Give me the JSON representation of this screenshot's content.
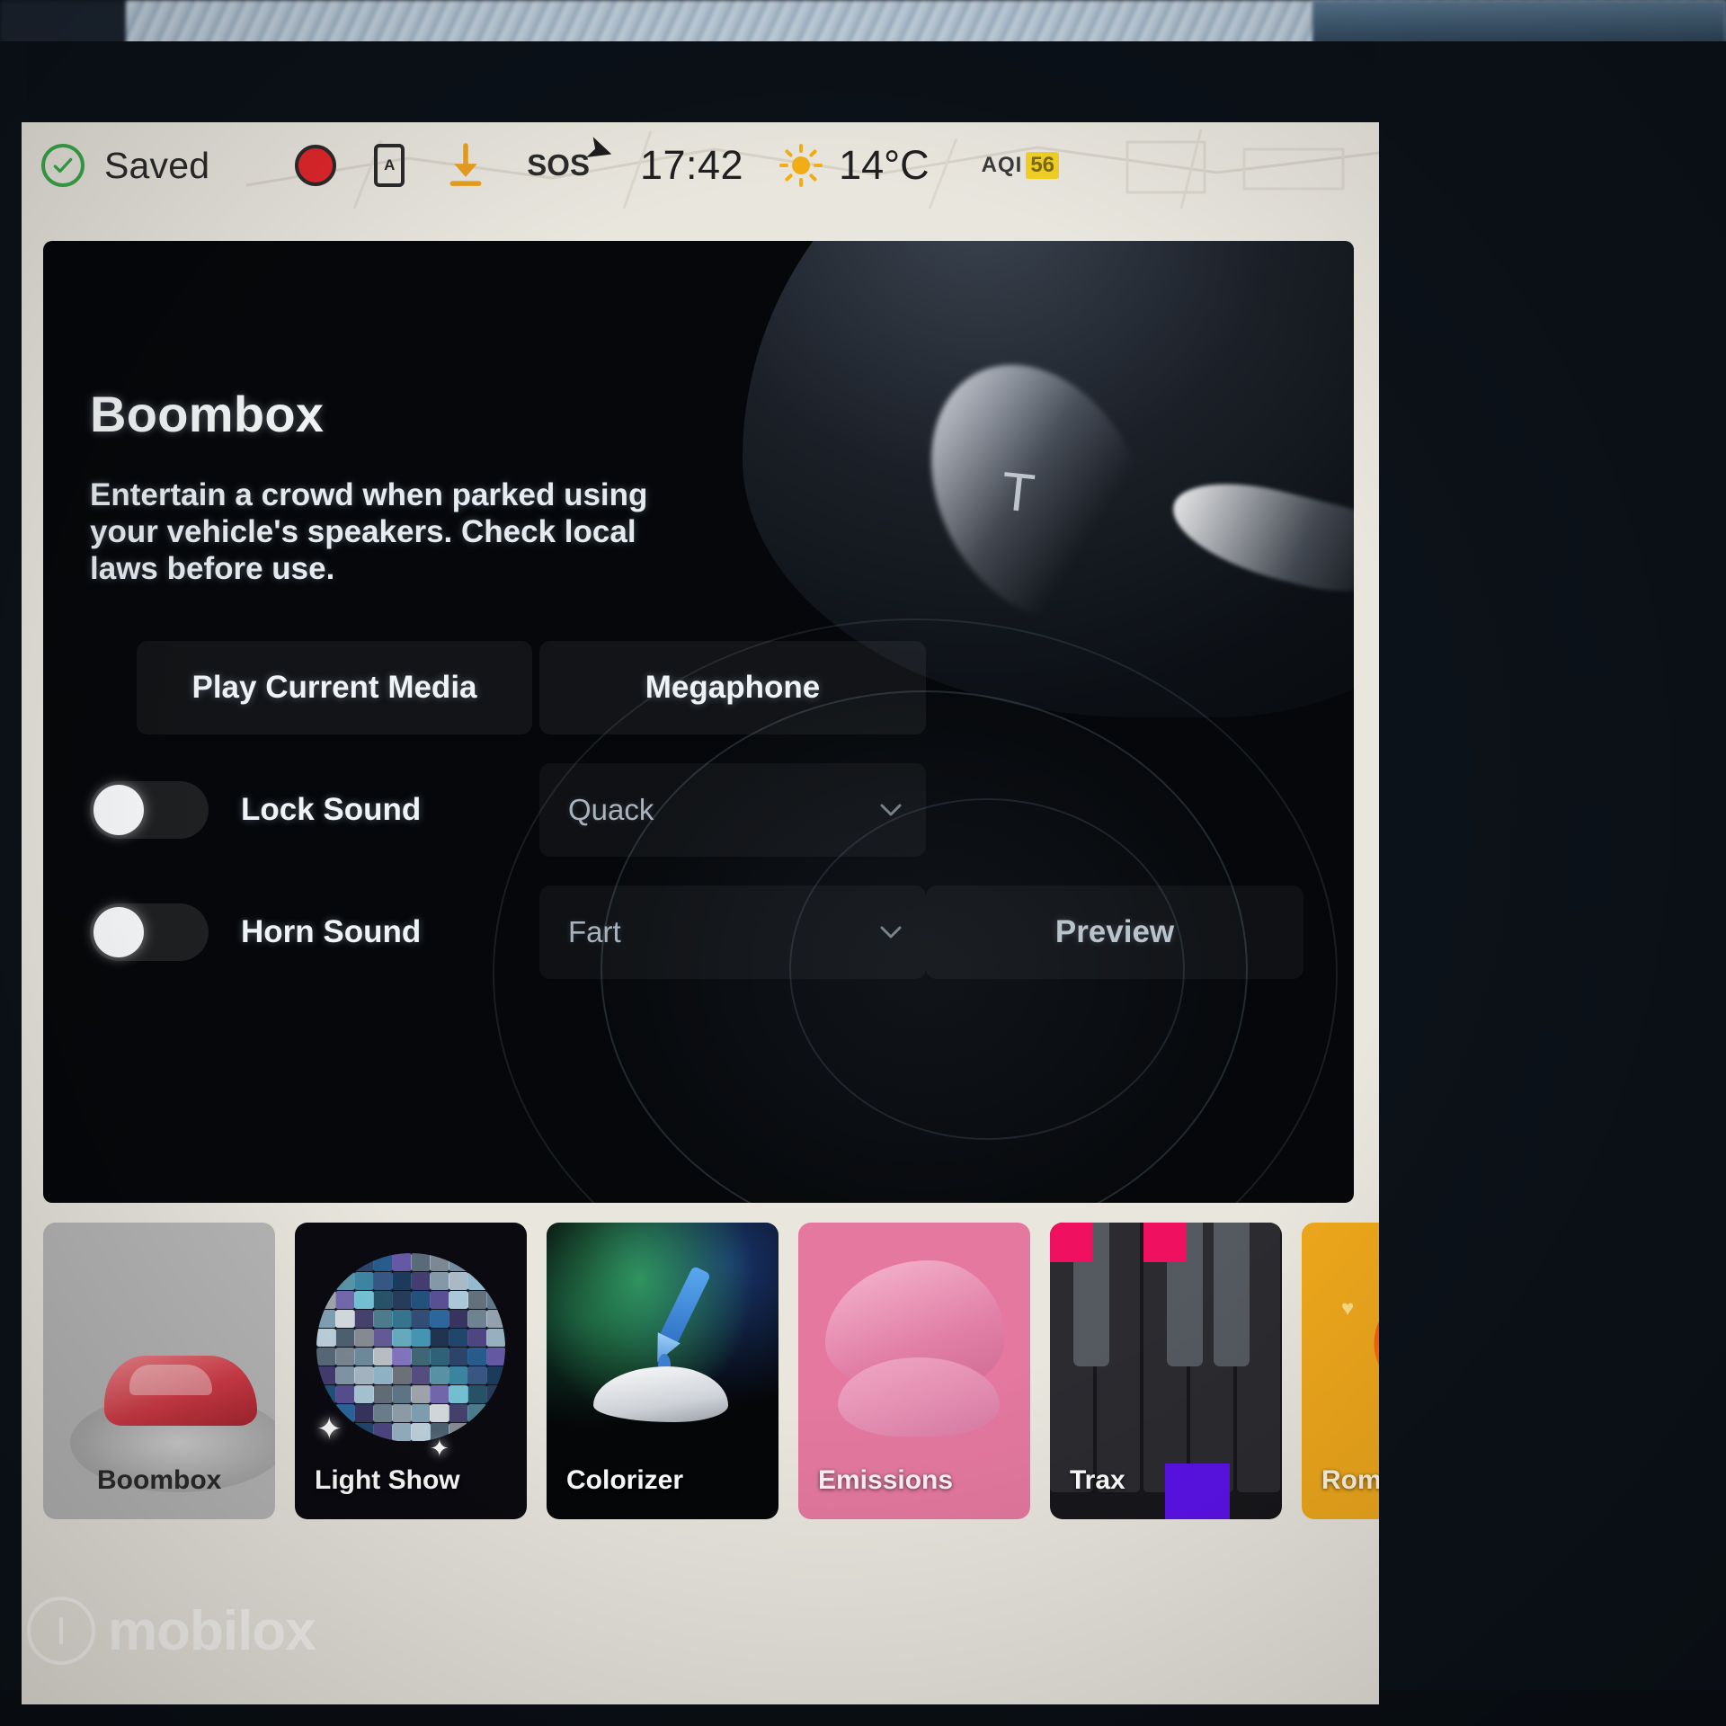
{
  "status_bar": {
    "saved_label": "Saved",
    "check_icon": "check-circle-icon",
    "record_icon": "record-dot-icon",
    "phone_icon": "phone-key-icon",
    "phone_glyph": "A",
    "download_icon": "download-arrow-icon",
    "sos_label": "SOS",
    "time": "17:42",
    "weather_icon": "sun-icon",
    "temperature": "14°C",
    "aqi_label": "AQI",
    "aqi_value": "56",
    "aqi_badge_color": "#f2d024"
  },
  "card": {
    "title": "Boombox",
    "description": "Entertain a crowd when parked using your vehicle's speakers. Check local laws before use.",
    "car_logo": "T"
  },
  "controls": {
    "play_current_media": "Play Current Media",
    "megaphone": "Megaphone",
    "lock_sound": {
      "label": "Lock Sound",
      "toggle_state": "off",
      "selected_sound": "Quack",
      "chevron_icon": "chevron-down-icon"
    },
    "horn_sound": {
      "label": "Horn Sound",
      "toggle_state": "off",
      "selected_sound": "Fart",
      "chevron_icon": "chevron-down-icon"
    },
    "preview": "Preview"
  },
  "tray": {
    "tiles": [
      {
        "label": "Boombox",
        "icon": "car-on-turntable-icon",
        "selected": true,
        "bg": "#b6b6b6"
      },
      {
        "label": "Light Show",
        "icon": "disco-ball-icon",
        "selected": false,
        "bg": "#0a0a10"
      },
      {
        "label": "Colorizer",
        "icon": "eyedropper-icon",
        "selected": false,
        "bg": "#050608"
      },
      {
        "label": "Emissions",
        "icon": "pink-blob-icon",
        "selected": false,
        "bg": "#e4789f"
      },
      {
        "label": "Trax",
        "icon": "piano-keys-icon",
        "selected": false,
        "bg": "#17171b"
      },
      {
        "label": "Romance",
        "icon": "campfire-icon",
        "selected": false,
        "bg": "#efa81c"
      }
    ]
  },
  "watermark": {
    "text": "mobilox"
  }
}
